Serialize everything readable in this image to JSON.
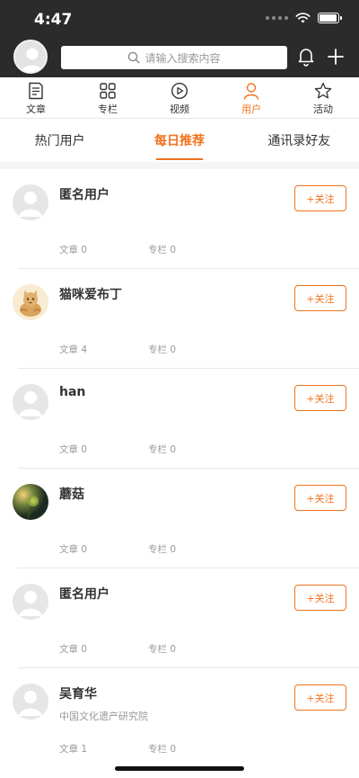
{
  "status_bar": {
    "time": "4:47"
  },
  "header": {
    "search_placeholder": "请输入搜索内容"
  },
  "tabs": [
    {
      "label": "文章",
      "icon": "article-icon"
    },
    {
      "label": "专栏",
      "icon": "grid-icon"
    },
    {
      "label": "视频",
      "icon": "play-icon"
    },
    {
      "label": "用户",
      "icon": "user-icon"
    },
    {
      "label": "活动",
      "icon": "star-icon"
    }
  ],
  "active_tab": "用户",
  "subtabs": [
    {
      "label": "热门用户"
    },
    {
      "label": "每日推荐"
    },
    {
      "label": "通讯录好友"
    }
  ],
  "active_subtab": "每日推荐",
  "users": [
    {
      "name": "匿名用户",
      "articles": "文章 0",
      "columns": "专栏 0",
      "follow": "+关注",
      "desc": "",
      "avatar": "default"
    },
    {
      "name": "猫咪爱布丁",
      "articles": "文章 4",
      "columns": "专栏 0",
      "follow": "+关注",
      "desc": "",
      "avatar": "cat"
    },
    {
      "name": "han",
      "articles": "文章 0",
      "columns": "专栏 0",
      "follow": "+关注",
      "desc": "",
      "avatar": "default"
    },
    {
      "name": "蘑菇",
      "articles": "文章 0",
      "columns": "专栏 0",
      "follow": "+关注",
      "desc": "",
      "avatar": "photo"
    },
    {
      "name": "匿名用户",
      "articles": "文章 0",
      "columns": "专栏 0",
      "follow": "+关注",
      "desc": "",
      "avatar": "default"
    },
    {
      "name": "吴育华",
      "articles": "文章 1",
      "columns": "专栏 0",
      "follow": "+关注",
      "desc": "中国文化遗产研究院",
      "avatar": "default"
    }
  ],
  "colors": {
    "accent": "#f0731e",
    "header_bg": "#2b2b2b"
  }
}
